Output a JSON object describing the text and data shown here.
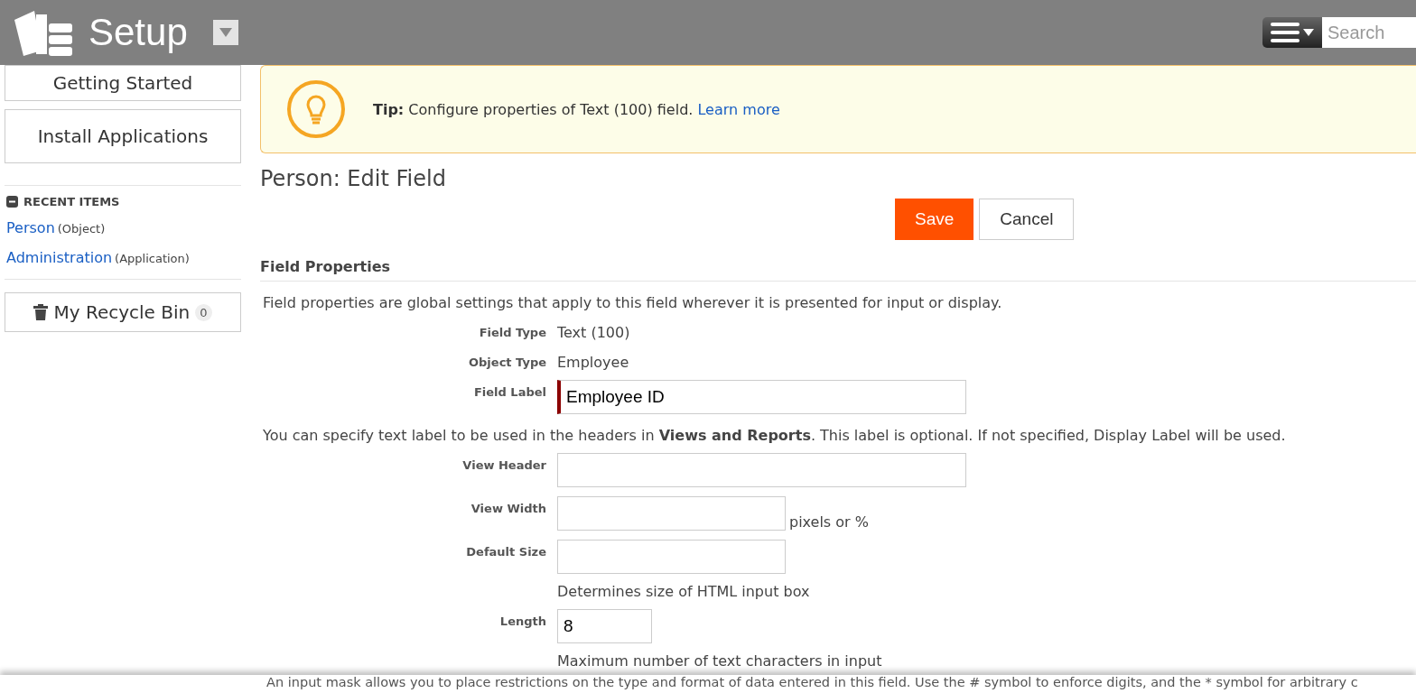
{
  "header": {
    "title": "Setup",
    "search": {
      "placeholder": "Search"
    }
  },
  "sidebar": {
    "buttons": [
      "Getting Started",
      "Install Applications"
    ],
    "recent": {
      "title": "RECENT ITEMS",
      "expanded": true,
      "items": [
        {
          "link": "Person",
          "type": "(Object)"
        },
        {
          "link": "Administration",
          "type": "(Application)"
        }
      ]
    },
    "recycle_bin": {
      "label": "My Recycle Bin",
      "count": "0"
    }
  },
  "tip": {
    "lead": "Tip:",
    "text": "Configure properties of Text (100) field.",
    "link": "Learn more"
  },
  "page_title": "Person: Edit Field",
  "actions": {
    "save": "Save",
    "cancel": "Cancel"
  },
  "section": {
    "title": "Field Properties",
    "intro": "Field properties are global settings that apply to this field wherever it is presented for input or display.",
    "rows": [
      {
        "kind": "static",
        "label": "Field Type",
        "value": "Text (100)"
      },
      {
        "kind": "static",
        "label": "Object Type",
        "value": "Employee"
      },
      {
        "kind": "wide_input",
        "label": "Field Label",
        "value": "Employee ID",
        "required": true
      },
      {
        "kind": "note",
        "text": "You can specify text label to be used in the headers in **Views and Reports**. This label is optional. If not specified, Display Label will be used."
      },
      {
        "kind": "wide_input",
        "label": "View Header",
        "required": false
      },
      {
        "kind": "short_input",
        "label": "View Width",
        "required": false,
        "suffix": "pixels or %"
      },
      {
        "kind": "short_input",
        "label": "Default Size",
        "required": false,
        "hint": "Determines size of HTML input box"
      },
      {
        "kind": "number_input",
        "label": "Length",
        "value": "8",
        "required": false,
        "hint": "Maximum number of text characters in input"
      }
    ],
    "footer": "An input mask allows you to place restrictions on the type and format of data entered in this field. Use the # symbol to enforce digits, and the * symbol for arbitrary c"
  }
}
